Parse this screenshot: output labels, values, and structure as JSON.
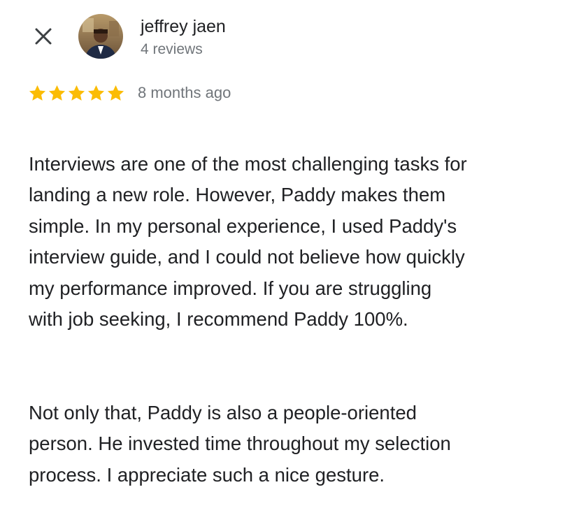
{
  "header": {
    "close_icon": "close-icon"
  },
  "author": {
    "name": "jeffrey jaen",
    "meta": "4 reviews",
    "avatar_icon": "profile-photo"
  },
  "rating": {
    "stars": 5,
    "max_stars": 5,
    "star_color": "#fbbc04",
    "time_ago": "8 months ago"
  },
  "review": {
    "paragraphs": [
      "Interviews are one of the most challenging tasks for\nlanding a new role. However, Paddy makes them\nsimple. In my personal experience, I used Paddy's\ninterview guide, and I could not believe how quickly\nmy performance improved. If you are struggling\nwith job seeking, I recommend Paddy 100%.",
      "Not only that, Paddy is also a people-oriented\nperson. He invested time throughout my selection\nprocess. I appreciate such a nice gesture."
    ]
  }
}
